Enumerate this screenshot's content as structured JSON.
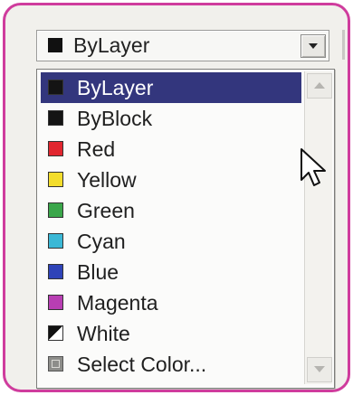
{
  "combo": {
    "selected_label": "ByLayer",
    "selected_color": "#141414"
  },
  "list": {
    "items": [
      {
        "label": "ByLayer",
        "swatch": "black",
        "color": "#141414",
        "selected": true
      },
      {
        "label": "ByBlock",
        "swatch": "black",
        "color": "#141414",
        "selected": false
      },
      {
        "label": "Red",
        "swatch": "red",
        "color": "#e1262f",
        "selected": false
      },
      {
        "label": "Yellow",
        "swatch": "yellow",
        "color": "#f3dd2c",
        "selected": false
      },
      {
        "label": "Green",
        "swatch": "green",
        "color": "#3aa64a",
        "selected": false
      },
      {
        "label": "Cyan",
        "swatch": "cyan",
        "color": "#3bb8d6",
        "selected": false
      },
      {
        "label": "Blue",
        "swatch": "blue",
        "color": "#2e43b8",
        "selected": false
      },
      {
        "label": "Magenta",
        "swatch": "magenta",
        "color": "#b83eb3",
        "selected": false
      },
      {
        "label": "White",
        "swatch": "black-white-split",
        "color": "#ffffff",
        "selected": false
      },
      {
        "label": "Select Color...",
        "swatch": "select-color",
        "color": "#8d8d8a",
        "selected": false
      }
    ]
  },
  "colors": {
    "frame_border": "#cf3c9d",
    "selection_bg": "#33367d"
  },
  "icons": {
    "dropdown_arrow": "chevron-down-icon",
    "scroll_up": "arrow-up-icon",
    "scroll_down": "arrow-down-icon",
    "cursor": "mouse-pointer-icon"
  }
}
